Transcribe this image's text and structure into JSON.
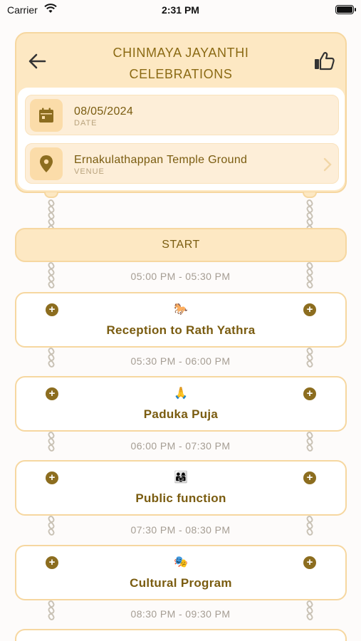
{
  "status_bar": {
    "carrier": "Carrier",
    "time": "2:31 PM"
  },
  "header": {
    "title_line1": "CHINMAYA JAYANTHI",
    "title_line2": "CELEBRATIONS",
    "date_value": "08/05/2024",
    "date_label": "DATE",
    "venue_value": "Ernakulathappan Temple Ground",
    "venue_label": "VENUE"
  },
  "start_label": "START",
  "events": [
    {
      "time": "05:00 PM - 05:30 PM",
      "emoji": "🐎",
      "title": "Reception to Rath Yathra"
    },
    {
      "time": "05:30 PM - 06:00 PM",
      "emoji": "🙏",
      "title": "Paduka Puja"
    },
    {
      "time": "06:00 PM - 07:30 PM",
      "emoji": "👨‍👩‍👧",
      "title": "Public function"
    },
    {
      "time": "07:30 PM - 08:30 PM",
      "emoji": "🎭",
      "title": "Cultural Program"
    },
    {
      "time": "08:30 PM - 09:30 PM",
      "emoji": "",
      "title": ""
    }
  ],
  "colors": {
    "accent": "#8b6a14",
    "header_bg": "#fde8c3",
    "card_border": "#f6d7a0",
    "time_text": "#a59d93"
  },
  "icons": {
    "back": "arrow-left-icon",
    "like": "thumbs-up-icon",
    "date": "calendar-icon",
    "venue": "location-pin-icon",
    "chevron": "chevron-right-icon",
    "plus": "plus-circle-icon",
    "chain": "chain-link-icon"
  }
}
